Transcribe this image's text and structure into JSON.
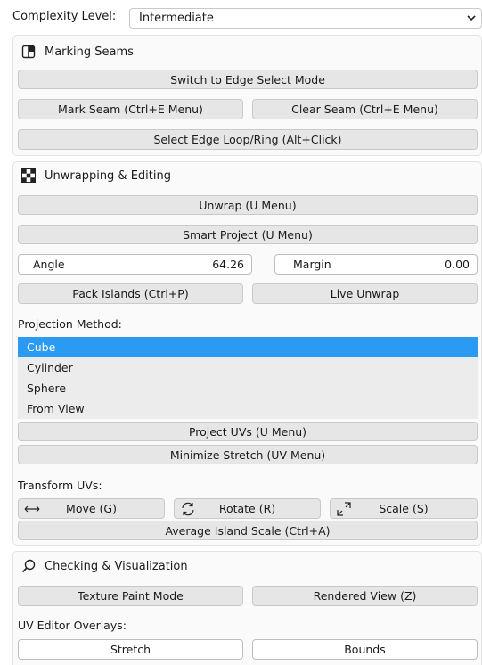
{
  "complexity": {
    "label": "Complexity Level:",
    "value": "Intermediate"
  },
  "marking_seams": {
    "title": "Marking Seams",
    "switch_edge": "Switch to Edge Select Mode",
    "mark_seam": "Mark Seam (Ctrl+E Menu)",
    "clear_seam": "Clear Seam (Ctrl+E Menu)",
    "select_loop": "Select Edge Loop/Ring (Alt+Click)"
  },
  "unwrapping": {
    "title": "Unwrapping & Editing",
    "unwrap": "Unwrap (U Menu)",
    "smart_project": "Smart Project (U Menu)",
    "angle_label": "Angle",
    "angle_value": "64.26",
    "margin_label": "Margin",
    "margin_value": "0.00",
    "pack_islands": "Pack Islands (Ctrl+P)",
    "live_unwrap": "Live Unwrap",
    "projection_label": "Projection Method:",
    "projection_items": [
      "Cube",
      "Cylinder",
      "Sphere",
      "From View"
    ],
    "project_uvs": "Project UVs (U Menu)",
    "minimize_stretch": "Minimize Stretch (UV Menu)",
    "transform_label": "Transform UVs:",
    "move": "Move (G)",
    "rotate": "Rotate (R)",
    "scale": "Scale (S)",
    "average_scale": "Average Island Scale (Ctrl+A)"
  },
  "checking": {
    "title": "Checking & Visualization",
    "texture_paint": "Texture Paint Mode",
    "rendered_view": "Rendered View (Z)",
    "overlays_label": "UV Editor Overlays:",
    "stretch": "Stretch",
    "bounds": "Bounds"
  },
  "colors": {
    "selection": "#2b9af3",
    "button": "#e6e6e6"
  }
}
